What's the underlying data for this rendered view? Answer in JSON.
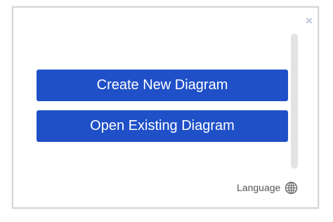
{
  "dialog": {
    "close_symbol": "×",
    "buttons": {
      "create_label": "Create New Diagram",
      "open_label": "Open Existing Diagram"
    },
    "language": {
      "label": "Language",
      "icon": "globe-icon"
    }
  },
  "colors": {
    "button_bg": "#1f50c8",
    "button_text": "#ffffff",
    "close_icon": "#b7c4d6",
    "scrollbar": "#e3e3e3"
  }
}
